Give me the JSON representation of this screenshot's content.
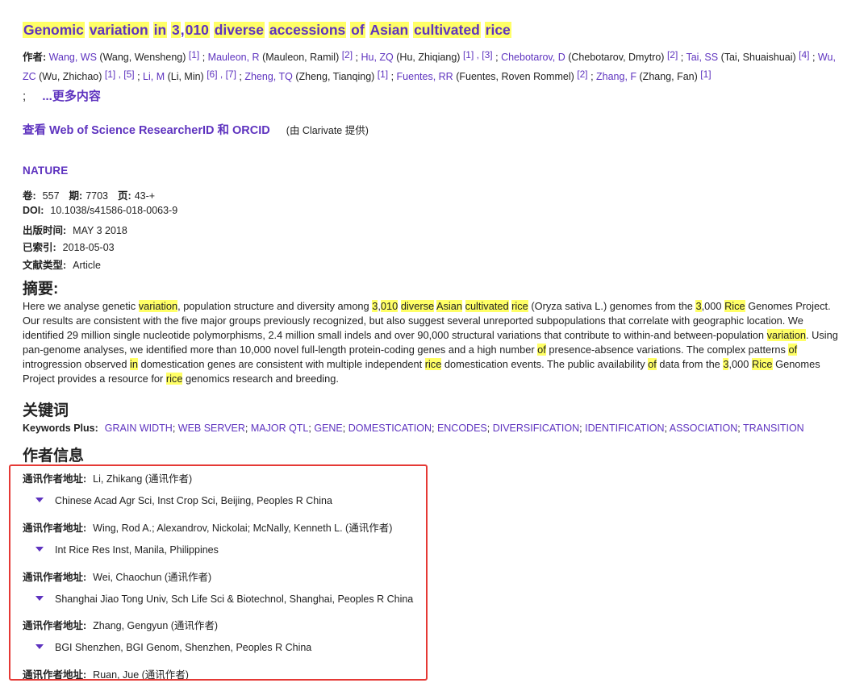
{
  "title_parts": [
    {
      "t": "Genomic",
      "hl": true
    },
    {
      "t": " ",
      "hl": false
    },
    {
      "t": "variation",
      "hl": true
    },
    {
      "t": " ",
      "hl": false
    },
    {
      "t": "in",
      "hl": true
    },
    {
      "t": " ",
      "hl": false
    },
    {
      "t": "3",
      "hl": true
    },
    {
      "t": ",",
      "hl": false
    },
    {
      "t": "010",
      "hl": true
    },
    {
      "t": " ",
      "hl": false
    },
    {
      "t": "diverse",
      "hl": true
    },
    {
      "t": " ",
      "hl": false
    },
    {
      "t": "accessions",
      "hl": true
    },
    {
      "t": " ",
      "hl": false
    },
    {
      "t": "of",
      "hl": true
    },
    {
      "t": " ",
      "hl": false
    },
    {
      "t": "Asian",
      "hl": true
    },
    {
      "t": " ",
      "hl": false
    },
    {
      "t": "cultivated",
      "hl": true
    },
    {
      "t": " ",
      "hl": false
    },
    {
      "t": "rice",
      "hl": true
    }
  ],
  "authors_label": "作者:",
  "authors": [
    {
      "short": "Wang, WS",
      "full": "(Wang, Wensheng)",
      "refs": [
        "[1]"
      ]
    },
    {
      "short": "Mauleon, R",
      "full": "(Mauleon, Ramil)",
      "refs": [
        "[2]"
      ]
    },
    {
      "short": "Hu, ZQ",
      "full": "(Hu, Zhiqiang)",
      "refs": [
        "[1]",
        "[3]"
      ]
    },
    {
      "short": "Chebotarov, D",
      "full": "(Chebotarov, Dmytro)",
      "refs": [
        "[2]"
      ]
    },
    {
      "short": "Tai, SS",
      "full": "(Tai, Shuaishuai)",
      "refs": [
        "[4]"
      ]
    },
    {
      "short": "Wu, ZC",
      "full": "(Wu, Zhichao)",
      "refs": [
        "[1]",
        "[5]"
      ]
    },
    {
      "short": "Li, M",
      "full": "(Li, Min)",
      "refs": [
        "[6]",
        "[7]"
      ]
    },
    {
      "short": "Zheng, TQ",
      "full": "(Zheng, Tianqing)",
      "refs": [
        "[1]"
      ]
    },
    {
      "short": "Fuentes, RR",
      "full": "(Fuentes, Roven Rommel)",
      "refs": [
        "[2]"
      ]
    },
    {
      "short": "Zhang, F",
      "full": "(Zhang, Fan)",
      "refs": [
        "[1]"
      ]
    }
  ],
  "more": {
    "semicolon": ";",
    "label": "...更多内容"
  },
  "researcher": {
    "link": "查看 Web of Science ResearcherID 和 ORCID",
    "provider": "(由 Clarivate 提供)"
  },
  "journal": "NATURE",
  "meta": {
    "volume_label": "卷:",
    "volume": "557",
    "issue_label": "期:",
    "issue": "7703",
    "pages_label": "页:",
    "pages": "43-+",
    "doi_label": "DOI:",
    "doi": "10.1038/s41586-018-0063-9",
    "pub_label": "出版时间:",
    "pub": "MAY 3 2018",
    "indexed_label": "已索引:",
    "indexed": "2018-05-03",
    "type_label": "文献类型:",
    "type": "Article"
  },
  "abstract_heading": "摘要:",
  "abstract_parts": [
    {
      "t": "Here we analyse genetic ",
      "hl": false
    },
    {
      "t": "variation",
      "hl": true
    },
    {
      "t": ", population structure and diversity among ",
      "hl": false
    },
    {
      "t": "3",
      "hl": true
    },
    {
      "t": ",",
      "hl": false
    },
    {
      "t": "010",
      "hl": true
    },
    {
      "t": " ",
      "hl": false
    },
    {
      "t": "diverse",
      "hl": true
    },
    {
      "t": " ",
      "hl": false
    },
    {
      "t": "Asian",
      "hl": true
    },
    {
      "t": " ",
      "hl": false
    },
    {
      "t": "cultivated",
      "hl": true
    },
    {
      "t": " ",
      "hl": false
    },
    {
      "t": "rice",
      "hl": true
    },
    {
      "t": " (Oryza sativa L.) genomes from the ",
      "hl": false
    },
    {
      "t": "3",
      "hl": true
    },
    {
      "t": ",000 ",
      "hl": false
    },
    {
      "t": "Rice",
      "hl": true
    },
    {
      "t": " Genomes Project. Our results are consistent with the five major groups previously recognized, but also suggest several unreported subpopulations that correlate with geographic location. We identified 29 million single nucleotide polymorphisms, 2.4 million small indels and over 90,000 structural variations that contribute to within-and between-population ",
      "hl": false
    },
    {
      "t": "variation",
      "hl": true
    },
    {
      "t": ". Using pan-genome analyses, we identified more than 10,000 novel full-length protein-coding genes and a high number ",
      "hl": false
    },
    {
      "t": "of",
      "hl": true
    },
    {
      "t": " presence-absence variations. The complex patterns ",
      "hl": false
    },
    {
      "t": "of",
      "hl": true
    },
    {
      "t": " introgression observed ",
      "hl": false
    },
    {
      "t": "in",
      "hl": true
    },
    {
      "t": " domestication genes are consistent with multiple independent ",
      "hl": false
    },
    {
      "t": "rice",
      "hl": true
    },
    {
      "t": " domestication events. The public availability ",
      "hl": false
    },
    {
      "t": "of",
      "hl": true
    },
    {
      "t": " data from the ",
      "hl": false
    },
    {
      "t": "3",
      "hl": true
    },
    {
      "t": ",000 ",
      "hl": false
    },
    {
      "t": "Rice",
      "hl": true
    },
    {
      "t": " Genomes Project provides a resource for ",
      "hl": false
    },
    {
      "t": "rice",
      "hl": true
    },
    {
      "t": " genomics research and breeding.",
      "hl": false
    }
  ],
  "keywords_heading": "关键词",
  "keywords_label": "Keywords Plus:",
  "keywords": [
    "GRAIN WIDTH",
    "WEB SERVER",
    "MAJOR QTL",
    "GENE",
    "DOMESTICATION",
    "ENCODES",
    "DIVERSIFICATION",
    "IDENTIFICATION",
    "ASSOCIATION",
    "TRANSITION"
  ],
  "author_info_heading": "作者信息",
  "corresponding": [
    {
      "label": "通讯作者地址:",
      "name": "Li, Zhikang (通讯作者)",
      "org": "Chinese Acad Agr Sci, Inst Crop Sci, Beijing, Peoples R China"
    },
    {
      "label": "通讯作者地址:",
      "name": "Wing, Rod A.; Alexandrov, Nickolai; McNally, Kenneth L. (通讯作者)",
      "org": "Int Rice Res Inst, Manila, Philippines"
    },
    {
      "label": "通讯作者地址:",
      "name": "Wei, Chaochun (通讯作者)",
      "org": "Shanghai Jiao Tong Univ, Sch Life Sci & Biotechnol, Shanghai, Peoples R China"
    },
    {
      "label": "通讯作者地址:",
      "name": "Zhang, Gengyun (通讯作者)",
      "org": "BGI Shenzhen, BGI Genom, Shenzhen, Peoples R China"
    },
    {
      "label": "通讯作者地址:",
      "name": "Ruan, Jue (通讯作者)",
      "org": ""
    }
  ],
  "colors": {
    "accent": "#5e33bf",
    "highlight": "#ffff66",
    "box": "#e53935"
  }
}
